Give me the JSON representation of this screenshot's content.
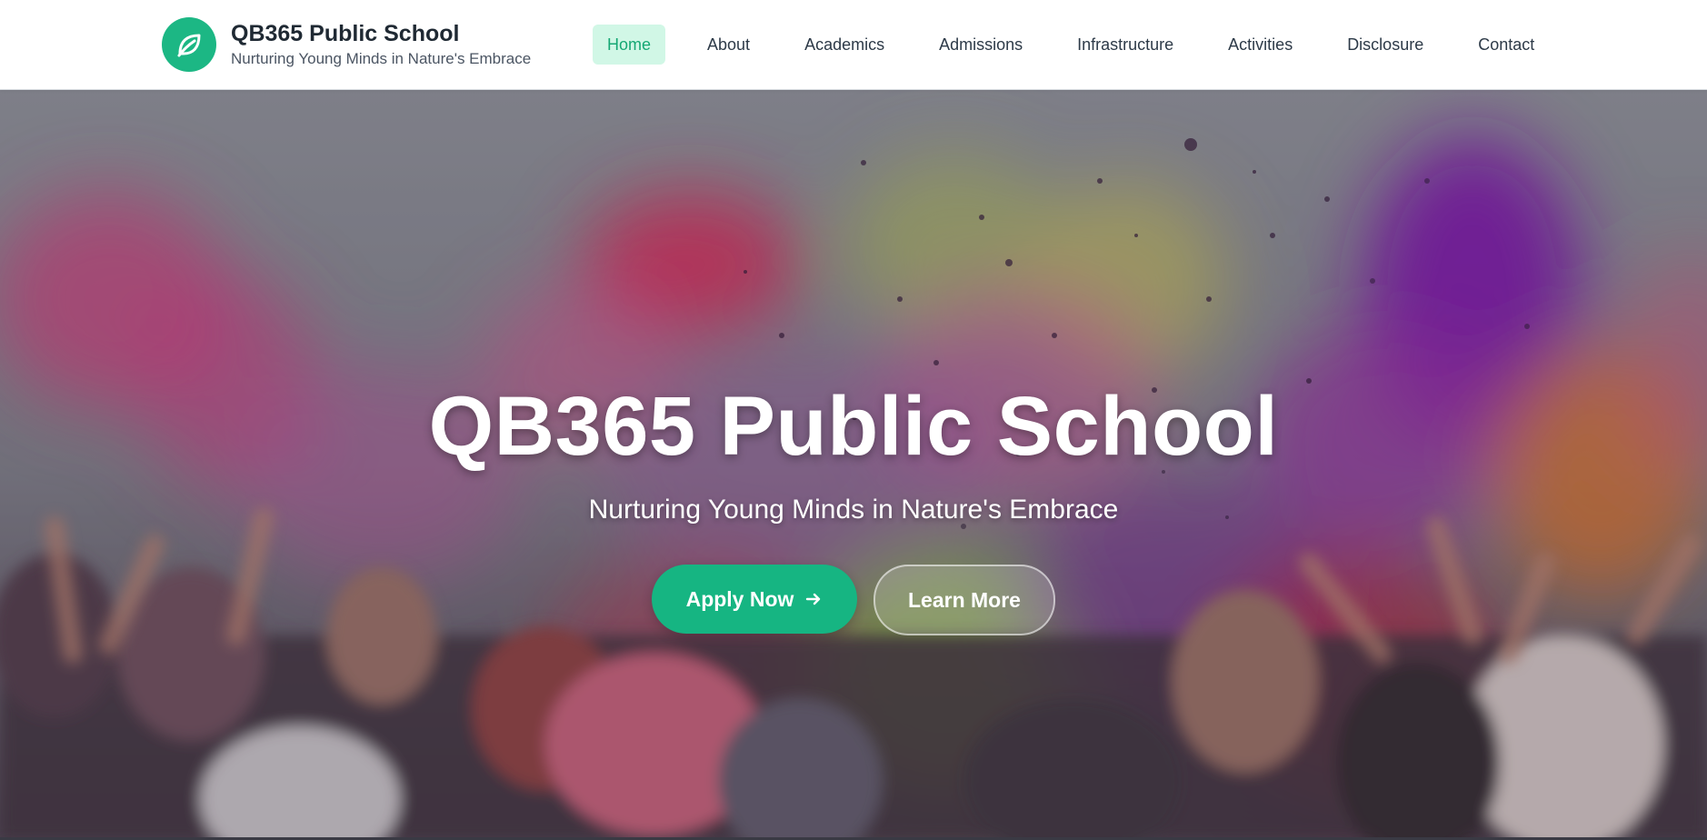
{
  "brand": {
    "name": "QB365 Public School",
    "tagline": "Nurturing Young Minds in Nature's Embrace",
    "logo_icon": "leaf-icon",
    "accent_color": "#1cb784"
  },
  "nav": {
    "active": "Home",
    "items": [
      {
        "label": "Home"
      },
      {
        "label": "About"
      },
      {
        "label": "Academics"
      },
      {
        "label": "Admissions"
      },
      {
        "label": "Infrastructure"
      },
      {
        "label": "Activities"
      },
      {
        "label": "Disclosure"
      },
      {
        "label": "Contact"
      }
    ]
  },
  "hero": {
    "title": "QB365 Public School",
    "subtitle": "Nurturing Young Minds in Nature's Embrace",
    "primary_button": "Apply Now",
    "primary_icon": "arrow-right-icon",
    "secondary_button": "Learn More",
    "background": "color-powder-festival-photo"
  }
}
